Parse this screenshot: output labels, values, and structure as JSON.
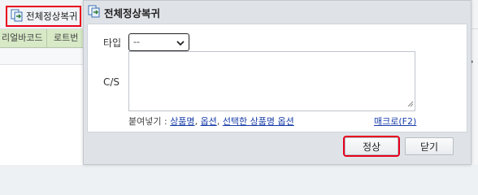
{
  "toolbar": {
    "restore_all_label": "전체정상복귀"
  },
  "grid": {
    "columns": [
      "리얼바코드",
      "로트번"
    ]
  },
  "dialog": {
    "title": "전체정상복귀",
    "type_label": "타입",
    "type_value": "--",
    "cs_label": "C/S",
    "cs_value": "",
    "paste_prefix": "붙여넣기 : ",
    "paste_links": [
      "상품명",
      "옵션",
      "선택한 상품명 옵션"
    ],
    "paste_separator": ", ",
    "macro_label": "매크로(F2)",
    "ok_label": "정상",
    "close_label": "닫기"
  },
  "colors": {
    "highlight": "#e8001c",
    "link": "#1a3ea8",
    "grid_header": "#d7e9c6"
  }
}
